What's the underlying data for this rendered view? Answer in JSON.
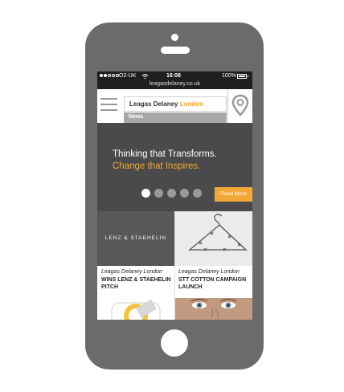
{
  "status_bar": {
    "carrier": "O2-UK",
    "time": "16:08",
    "battery": "100%"
  },
  "browser": {
    "url": "leagasdelaney.co.uk"
  },
  "header": {
    "brand_main": "Leagas Delaney",
    "brand_accent": "London",
    "section": "News"
  },
  "hero": {
    "line1": "Thinking that Transforms.",
    "line2": "Change that Inspires.",
    "cta": "Read More",
    "slides": 5,
    "active_slide": 1
  },
  "news": [
    {
      "image_text": "LENZ & STAEHELIN",
      "agency": "Leagas Delaney London",
      "title": "WINS LENZ & STAEHELIN PITCH"
    },
    {
      "image_text": "",
      "agency": "Leagas Delaney London",
      "title": "STT COTTON CAMPAIGN LAUNCH"
    }
  ],
  "colors": {
    "accent": "#f2a834",
    "phone_body": "#6b6b6b",
    "hero_bg": "#4a4a4c"
  }
}
